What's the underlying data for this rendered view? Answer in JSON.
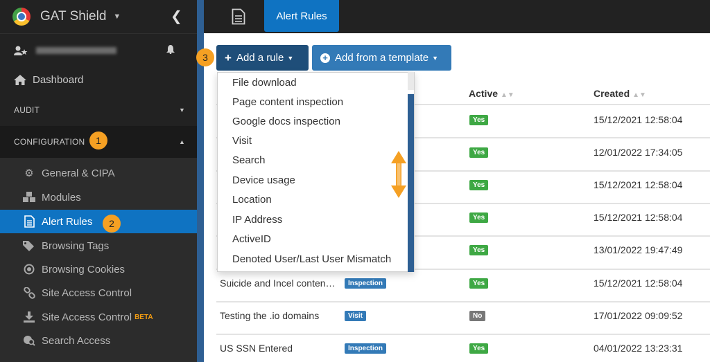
{
  "app": {
    "brand": "GAT Shield"
  },
  "sidebar": {
    "dashboard": "Dashboard",
    "audit": "AUDIT",
    "configuration": "CONFIGURATION",
    "items": [
      {
        "label": "General & CIPA",
        "icon": "gears-icon"
      },
      {
        "label": "Modules",
        "icon": "cubes-icon"
      },
      {
        "label": "Alert Rules",
        "icon": "document-icon",
        "active": true
      },
      {
        "label": "Browsing Tags",
        "icon": "tags-icon"
      },
      {
        "label": "Browsing Cookies",
        "icon": "dot-circle-icon"
      },
      {
        "label": "Site Access Control",
        "icon": "link-icon"
      },
      {
        "label": "Site Access Control",
        "icon": "download-icon",
        "badge": "BETA"
      },
      {
        "label": "Search Access",
        "icon": "globe-search-icon"
      }
    ]
  },
  "markers": [
    "1",
    "2",
    "3"
  ],
  "topbar": {
    "active_tab": "Alert Rules"
  },
  "toolbar": {
    "add_rule": "Add a rule",
    "add_template": "Add from a template"
  },
  "table": {
    "headers": {
      "active": "Active",
      "created": "Created"
    },
    "rows": [
      {
        "name": "",
        "type": "",
        "active": "Yes",
        "created": "15/12/2021 12:58:04"
      },
      {
        "name": "",
        "type": "",
        "active": "Yes",
        "created": "12/01/2022 17:34:05"
      },
      {
        "name": "",
        "type": "",
        "active": "Yes",
        "created": "15/12/2021 12:58:04"
      },
      {
        "name": "",
        "type": "",
        "active": "Yes",
        "created": "15/12/2021 12:58:04"
      },
      {
        "name": "",
        "type": "",
        "active": "Yes",
        "created": "13/01/2022 19:47:49"
      },
      {
        "name": "Suicide and Incel conten…",
        "type": "Inspection",
        "active": "Yes",
        "created": "15/12/2021 12:58:04"
      },
      {
        "name": "Testing the .io domains",
        "type": "Visit",
        "active": "No",
        "created": "17/01/2022 09:09:52"
      },
      {
        "name": "US SSN Entered",
        "type": "Inspection",
        "active": "Yes",
        "created": "04/01/2022 13:23:31"
      }
    ]
  },
  "dropdown": {
    "items": [
      "File download",
      "Page content inspection",
      "Google docs inspection",
      "Visit",
      "Search",
      "Device usage",
      "Location",
      "IP Address",
      "ActiveID",
      "Denoted User/Last User Mismatch"
    ]
  },
  "colors": {
    "accent": "#0f73c2",
    "marker": "#f5a023",
    "yes": "#3ea844",
    "no": "#777777"
  }
}
